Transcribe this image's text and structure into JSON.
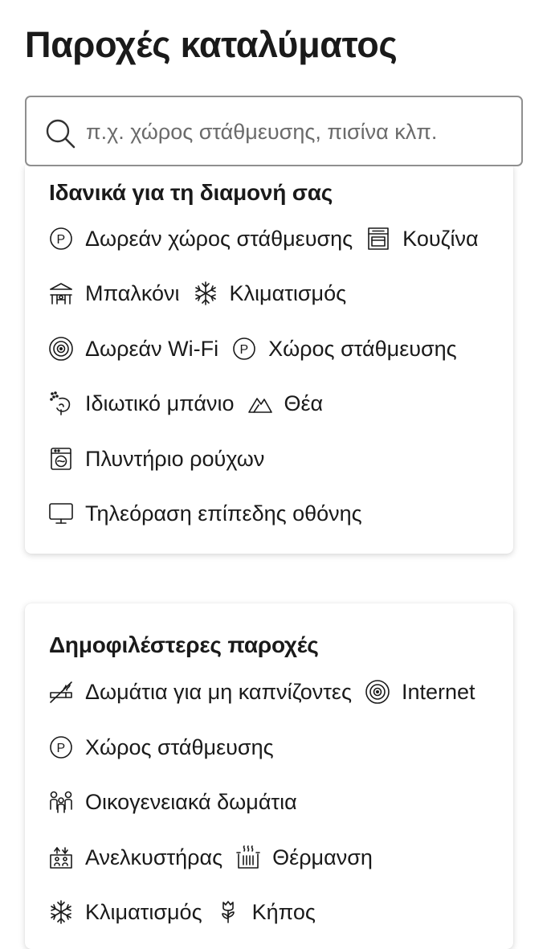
{
  "page": {
    "title": "Παροχές καταλύματος"
  },
  "search": {
    "placeholder": "π.χ. χώρος στάθμευσης, πισίνα κλπ.",
    "value": ""
  },
  "ideal": {
    "title": "Ιδανικά για τη διαμονή σας",
    "items": [
      {
        "icon": "parking-icon",
        "label": "Δωρεάν χώρος στάθμευσης"
      },
      {
        "icon": "kitchen-icon",
        "label": "Κουζίνα"
      },
      {
        "icon": "balcony-icon",
        "label": "Μπαλκόνι"
      },
      {
        "icon": "snowflake-icon",
        "label": "Κλιματισμός"
      },
      {
        "icon": "wifi-icon",
        "label": "Δωρεάν Wi-Fi"
      },
      {
        "icon": "parking-icon",
        "label": "Χώρος στάθμευσης"
      },
      {
        "icon": "shower-icon",
        "label": "Ιδιωτικό μπάνιο"
      },
      {
        "icon": "mountain-view-icon",
        "label": "Θέα"
      },
      {
        "icon": "washing-machine-icon",
        "label": "Πλυντήριο ρούχων"
      },
      {
        "icon": "tv-icon",
        "label": "Τηλεόραση επίπεδης οθόνης"
      }
    ]
  },
  "popular": {
    "title": "Δημοφιλέστερες παροχές",
    "items": [
      {
        "icon": "no-smoking-icon",
        "label": "Δωμάτια για μη καπνίζοντες"
      },
      {
        "icon": "internet-icon",
        "label": "Internet"
      },
      {
        "icon": "parking-icon",
        "label": "Χώρος στάθμευσης"
      },
      {
        "icon": "family-icon",
        "label": "Οικογενειακά δωμάτια"
      },
      {
        "icon": "elevator-icon",
        "label": "Ανελκυστήρας"
      },
      {
        "icon": "heating-icon",
        "label": "Θέρμανση"
      },
      {
        "icon": "snowflake-icon",
        "label": "Κλιματισμός"
      },
      {
        "icon": "garden-icon",
        "label": "Κήπος"
      }
    ]
  }
}
